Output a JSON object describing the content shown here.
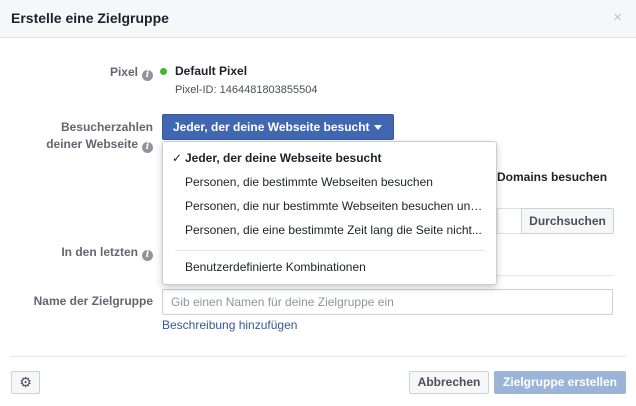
{
  "dialog": {
    "title": "Erstelle eine Zielgruppe",
    "close_icon": "×"
  },
  "pixel": {
    "label": "Pixel",
    "info_icon": "i",
    "status_color": "#42b72a",
    "name": "Default Pixel",
    "id_text": "Pixel-ID: 1464481803855504"
  },
  "visitors": {
    "label_line1": "Besucherzahlen",
    "label_line2": "deiner Webseite",
    "info_icon": "i",
    "selected": "Jeder, der deine Webseite besucht",
    "options": [
      {
        "label": "Jeder, der deine Webseite besucht",
        "selected": true
      },
      {
        "label": "Personen, die bestimmte Webseiten besuchen",
        "selected": false
      },
      {
        "label": "Personen, die nur bestimmte Webseiten besuchen und...",
        "selected": false
      },
      {
        "label": "Personen, die eine bestimmte Zeit lang die Seite nicht...",
        "selected": false
      },
      {
        "label": "Benutzerdefinierte Kombinationen",
        "selected": false
      }
    ],
    "check_mark": "✓"
  },
  "background": {
    "domains_text": "Domains besuchen",
    "browse_button": "Durchsuchen"
  },
  "last_days": {
    "label": "In den letzten",
    "info_icon": "i"
  },
  "audience_name": {
    "label": "Name der Zielgruppe",
    "value": "",
    "placeholder": "Gib einen Namen für deine Zielgruppe ein",
    "add_description_link": "Beschreibung hinzufügen"
  },
  "footer": {
    "gear_icon": "⚙",
    "cancel_label": "Abbrechen",
    "create_label": "Zielgruppe erstellen"
  },
  "colors": {
    "primary": "#4267b2",
    "primary_disabled": "#9cb4d8",
    "link": "#365899"
  }
}
